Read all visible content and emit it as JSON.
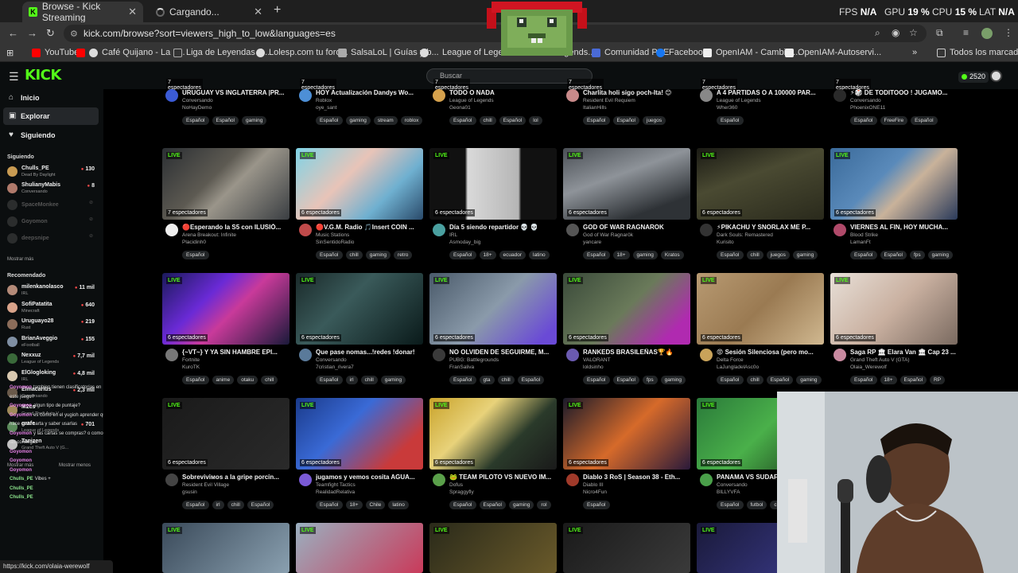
{
  "browser": {
    "tabs": [
      {
        "label": "Browse - Kick Streaming",
        "active": true
      },
      {
        "label": "Cargando...",
        "active": false
      }
    ],
    "url": "kick.com/browse?sort=viewers_high_to_low&languages=es",
    "stats": {
      "fps_label": "FPS",
      "fps": "N/A",
      "gpu_label": "GPU",
      "gpu": "19 %",
      "cpu_label": "CPU",
      "cpu": "15 %",
      "lat_label": "LAT",
      "lat": "N/A"
    },
    "bookmarks": [
      "YouTube",
      "Café Quijano - La L...",
      "Liga de Leyendas d...",
      "Lolesp.com tu foro...",
      "SalsaLoL | Guías y b...",
      "League of Legends",
      "...egends...",
      "Comunidad PBE",
      "Facebook",
      "OpenIAM - Cambiar...",
      "OpenIAM-Autoservi..."
    ],
    "bookmarks_all": "Todos los marcadores",
    "status_url": "https://kick.com/olaia-werewolf"
  },
  "header": {
    "logo": "KICK",
    "search_placeholder": "Buscar",
    "points": "2520"
  },
  "sidebar": {
    "nav": [
      "Inicio",
      "Explorar",
      "Siguiendo"
    ],
    "following_title": "Siguiendo",
    "following": [
      {
        "name": "Chulls_PE",
        "game": "Dead By Daylight",
        "viewers": "130",
        "online": true,
        "color": "#c99b52"
      },
      {
        "name": "ShulianyMabis",
        "game": "Conversando",
        "viewers": "8",
        "online": true,
        "color": "#b07a6b"
      },
      {
        "name": "SpaceMonkee",
        "game": "",
        "viewers": "",
        "online": false,
        "color": "#666666"
      },
      {
        "name": "Goyomon",
        "game": "",
        "viewers": "",
        "online": false,
        "color": "#666666"
      },
      {
        "name": "deepsnipe",
        "game": "",
        "viewers": "",
        "online": false,
        "color": "#666666"
      }
    ],
    "show_more": "Mostrar más",
    "recommended_title": "Recomendado",
    "recommended": [
      {
        "name": "milenkanolasco",
        "game": "IRL",
        "viewers": "11 mil",
        "color": "#b48a78"
      },
      {
        "name": "SofiPatatita",
        "game": "Minecraft",
        "viewers": "640",
        "color": "#d9a38a"
      },
      {
        "name": "Uruguayo28",
        "game": "Rust",
        "viewers": "219",
        "color": "#8c6d5a"
      },
      {
        "name": "BrianAveggio",
        "game": "eFootball",
        "viewers": "155",
        "color": "#7f8fa3"
      },
      {
        "name": "Nexxuz",
        "game": "League of Legends",
        "viewers": "7,7 mil",
        "color": "#3a6a3a"
      },
      {
        "name": "ElGlogloking",
        "game": "IRL",
        "viewers": "4,8 mil",
        "color": "#d9c9b0"
      },
      {
        "name": "Elmacarius",
        "game": "Conversando",
        "viewers": "2,3 mil",
        "color": "#6a5a4a"
      },
      {
        "name": "M2cs",
        "game": "Grand Theft Auto V",
        "viewers": "",
        "color": "#a08a5a"
      },
      {
        "name": "grafe",
        "game": "League of Legends",
        "viewers": "701",
        "color": "#5a8a5a"
      },
      {
        "name": "Tanizen",
        "game": "Grand Theft Auto V (G...",
        "viewers": "",
        "color": "#c0c0c0"
      }
    ],
    "show_less": "Mostrar menos",
    "show_more_2": "Mostrar más"
  },
  "chat": [
    {
      "user": "Goyomon",
      "text": "tambien tienen clasificatorias en",
      "cls": ""
    },
    {
      "user": "",
      "text": "este juego?",
      "cls": ""
    },
    {
      "user": "Goyomon",
      "text": "algun tipo de puntaje?",
      "cls": ""
    },
    {
      "user": "Goyomon",
      "text": "es como en el yugioh aprender que",
      "cls": ""
    },
    {
      "user": "",
      "text": "hace cada carta y saber usarlas",
      "cls": ""
    },
    {
      "user": "Goyomon",
      "text": "y las cartas se compras? o como",
      "cls": ""
    },
    {
      "user": "",
      "text": "las consegus",
      "cls": ""
    },
    {
      "user": "Goyomon",
      "text": "",
      "cls": ""
    },
    {
      "user": "Goyomon",
      "text": "",
      "cls": ""
    },
    {
      "user": "Goyomon",
      "text": "",
      "cls": ""
    },
    {
      "user": "Chulls_PE",
      "text": "Vibes +",
      "cls": "g"
    },
    {
      "user": "Chulls_PE",
      "text": "",
      "cls": "g"
    },
    {
      "user": "Chulls_PE",
      "text": "",
      "cls": "g"
    }
  ],
  "live_label": "LIVE",
  "top_row": [
    {
      "viewers": "7 espectadores",
      "title": "URUGUAY VS INGLATERRA |PR...",
      "cat": "Conversando",
      "name": "NoHayDemo",
      "tags": [
        "Español",
        "Español",
        "gaming"
      ],
      "av": "#3b5bd6"
    },
    {
      "viewers": "7 espectadores",
      "title": "HOY Actualización Dandys Wo...",
      "cat": "Roblox",
      "name": "oye_sant",
      "tags": [
        "Español",
        "gaming",
        "stream",
        "roblox"
      ],
      "av": "#4d8fd6"
    },
    {
      "viewers": "7 espectadores",
      "title": "TODO O NADA",
      "cat": "League of Legends",
      "name": "Geona01",
      "tags": [
        "Español",
        "chill",
        "Español",
        "lol"
      ],
      "av": "#d6a24d"
    },
    {
      "viewers": "7 espectadores",
      "title": "Charlita holi sigo poch-Ita! 😊",
      "cat": "Resident Evil Requiem",
      "name": "ItalianHills",
      "tags": [
        "Español",
        "Español",
        "juegos"
      ],
      "av": "#c98a8a"
    },
    {
      "viewers": "7 espectadores",
      "title": "A 4 PARTIDAS O A 100000 PAR...",
      "cat": "League of Legends",
      "name": "Wher360",
      "tags": [
        "Español"
      ],
      "av": "#888888"
    },
    {
      "viewers": "7 espectadores",
      "title": "⚡🎲 DE TODITOOO ! JUGAMO...",
      "cat": "Conversando",
      "name": "PhoenixONE11",
      "tags": [
        "Español",
        "FreeFire",
        "Español"
      ],
      "av": "#2a2a2a"
    }
  ],
  "cards": [
    {
      "viewers": "7 espectadores",
      "title": "🔴Esperando la S5 con ILUSIÓ...",
      "cat": "Arena Breakout: Infinite",
      "name": "Placidinh0",
      "tags": [
        "Español"
      ],
      "av": "#eeeeee",
      "bg": "linear-gradient(135deg,#2b2f33 0%,#5d5a52 40%,#9a958a 55%,#3a3e42 100%)"
    },
    {
      "viewers": "6 espectadores",
      "title": "🔴V.G.M. Radio 🎵Insert COIN ...",
      "cat": "Music Stations",
      "name": "SinSentidoRadio",
      "tags": [
        "Español",
        "chill",
        "gaming",
        "retro"
      ],
      "av": "#c04a4a",
      "bg": "linear-gradient(135deg,#7fd3e6 0%,#e8c4b8 40%,#6fb0d0 70%,#2a4a6a 100%)"
    },
    {
      "viewers": "6 espectadores",
      "title": "Día 5 siendo repartidor 💀 💀",
      "cat": "IRL",
      "name": "Asmoday_big",
      "tags": [
        "Español",
        "18+",
        "ecuador",
        "latino"
      ],
      "av": "#4aa0a0",
      "bg": "linear-gradient(90deg,#111 0%,#111 28%,#d9d9d9 30%,#b5b5b5 70%,#111 72%,#111 100%)"
    },
    {
      "viewers": "6 espectadores",
      "title": "GOD OF WAR RAGNAROK",
      "cat": "God of War Ragnarök",
      "name": "yancare",
      "tags": [
        "Español",
        "18+",
        "gaming",
        "Kratos"
      ],
      "av": "#555555",
      "bg": "linear-gradient(160deg,#4a4f55 0%,#8e9399 40%,#2e3236 80%)"
    },
    {
      "viewers": "6 espectadores",
      "title": "⚡PIKACHU Y SNORLAX ME P...",
      "cat": "Dark Souls: Remastered",
      "name": "Kurisito",
      "tags": [
        "Español",
        "chill",
        "juegos",
        "gaming"
      ],
      "av": "#333333",
      "bg": "linear-gradient(160deg,#1a1a14 0%,#4a4a32 40%,#2a2a1c 100%)"
    },
    {
      "viewers": "6 espectadores",
      "title": "VIERNES AL FIN, HOY MUCHA...",
      "cat": "Blood Strike",
      "name": "LamanFt",
      "tags": [
        "Español",
        "Español",
        "fps",
        "gaming"
      ],
      "av": "#b04a6a",
      "bg": "linear-gradient(135deg,#3a6a9a 0%,#5a8aba 40%,#c9b29a 60%,#2a3a5a 100%)"
    },
    {
      "viewers": "6 espectadores",
      "title": "{~VT~} Y YA SIN HAMBRE EPI...",
      "cat": "Fortnite",
      "name": "KuroTK",
      "tags": [
        "Español",
        "anime",
        "otaku",
        "chill"
      ],
      "av": "#777777",
      "bg": "linear-gradient(135deg,#1a1a5a 0%,#6a2ad6 35%,#c93a9a 55%,#1a1a3a 100%)"
    },
    {
      "viewers": "6 espectadores",
      "title": "Que pase nomas...!redes !donar!",
      "cat": "Conversando",
      "name": "7cristian_rivera7",
      "tags": [
        "Español",
        "irl",
        "chill",
        "gaming"
      ],
      "av": "#5a7a9a",
      "bg": "linear-gradient(135deg,#1a2a2a 0%,#3a5a5a 40%,#0a1a1a 100%)"
    },
    {
      "viewers": "6 espectadores",
      "title": "NO OLVIDEN DE SEGUIRME, M...",
      "cat": "PUBG: Battlegrounds",
      "name": "FranSaliva",
      "tags": [
        "Español",
        "gta",
        "chill",
        "Español"
      ],
      "av": "#3a3a3a",
      "bg": "linear-gradient(135deg,#4a5a6a 0%,#8a9aaa 50%,#6a4ad6 90%)"
    },
    {
      "viewers": "6 espectadores",
      "title": "RANKEDS BRASILEÑAS🏆🔥",
      "cat": "VALORANT",
      "name": "loldsinho",
      "tags": [
        "Español",
        "Español",
        "fps",
        "gaming"
      ],
      "av": "#6a5ab0",
      "bg": "linear-gradient(135deg,#3a4a3a 0%,#6a7a5a 50%,#b02ab0 85%)"
    },
    {
      "viewers": "6 espectadores",
      "title": "😡 Sesión Silenciosa (pero mo...",
      "cat": "Delta Force",
      "name": "LaJungladelAsc0o",
      "tags": [
        "Español",
        "chill",
        "Español",
        "gaming"
      ],
      "av": "#c9a35a",
      "bg": "linear-gradient(135deg,#b89a72 0%,#9a7a52 50%,#d0b890 100%)"
    },
    {
      "viewers": "6 espectadores",
      "title": "Saga RP 🏛 Elara Van 🏛 Cap 23 ...",
      "cat": "Grand Theft Auto V (GTA)",
      "name": "Olaia_Werewolf",
      "tags": [
        "Español",
        "18+",
        "Español",
        "RP"
      ],
      "av": "#c98aa0",
      "bg": "linear-gradient(135deg,#e8e0d8 0%,#c9b0a0 50%,#7a6a60 100%)"
    },
    {
      "viewers": "6 espectadores",
      "title": "Sobreviviмos a la gripe porcin...",
      "cat": "Resident Evil Village",
      "name": "gsusin",
      "tags": [
        "Español",
        "irl",
        "chill",
        "Español"
      ],
      "av": "#444444",
      "bg": "linear-gradient(135deg,#1a1a1a 0%,#2a2a2a 100%)"
    },
    {
      "viewers": "6 espectadores",
      "title": "jugamos y vemos cosita AGUA...",
      "cat": "Teamfight Tactics",
      "name": "RealidadRelativa",
      "tags": [
        "Español",
        "18+",
        "Chile",
        "latino"
      ],
      "av": "#7a5ad6",
      "bg": "linear-gradient(135deg,#1a3a8a 0%,#3a6ad6 40%,#c93a3a 80%)"
    },
    {
      "viewers": "6 espectadores",
      "title": "🐸 TEAM PILOTO VS NUEVO IM...",
      "cat": "Dofus",
      "name": "Spraggyfly",
      "tags": [
        "Español",
        "Español",
        "gaming",
        "rol"
      ],
      "av": "#5aa04a",
      "bg": "linear-gradient(135deg,#c9a32a 0%,#e8d27a 35%,#2a3a2a 65%,#1a1a1a 100%)"
    },
    {
      "viewers": "6 espectadores",
      "title": "Diablo 3 RoS | Season 38 - Eth...",
      "cat": "Diablo III",
      "name": "Nicro4Fun",
      "tags": [
        "Español"
      ],
      "av": "#a03a2a",
      "bg": "linear-gradient(135deg,#1a1a2a 0%,#d66a2a 50%,#2a1a3a 100%)"
    },
    {
      "viewers": "6 espectadores",
      "title": "PANAMA VS SUDAFRICA",
      "cat": "Conversando",
      "name": "BILLYVFA",
      "tags": [
        "Español",
        "futbol",
        "chill"
      ],
      "av": "#4aa04a",
      "bg": "linear-gradient(135deg,#2a7a3a 0%,#4ab04a 50%,#1a3a1a 100%)"
    }
  ],
  "bottom_row_bg": [
    "linear-gradient(135deg,#3a4a5a,#8aa0b0)",
    "linear-gradient(135deg,#9ab0c0,#c93a5a)",
    "linear-gradient(135deg,#2a2a1a,#6a5a2a)",
    "linear-gradient(135deg,#1a1a1a,#3a3a3a)",
    "linear-gradient(135deg,#1a1a3a,#3a3a8a)"
  ]
}
